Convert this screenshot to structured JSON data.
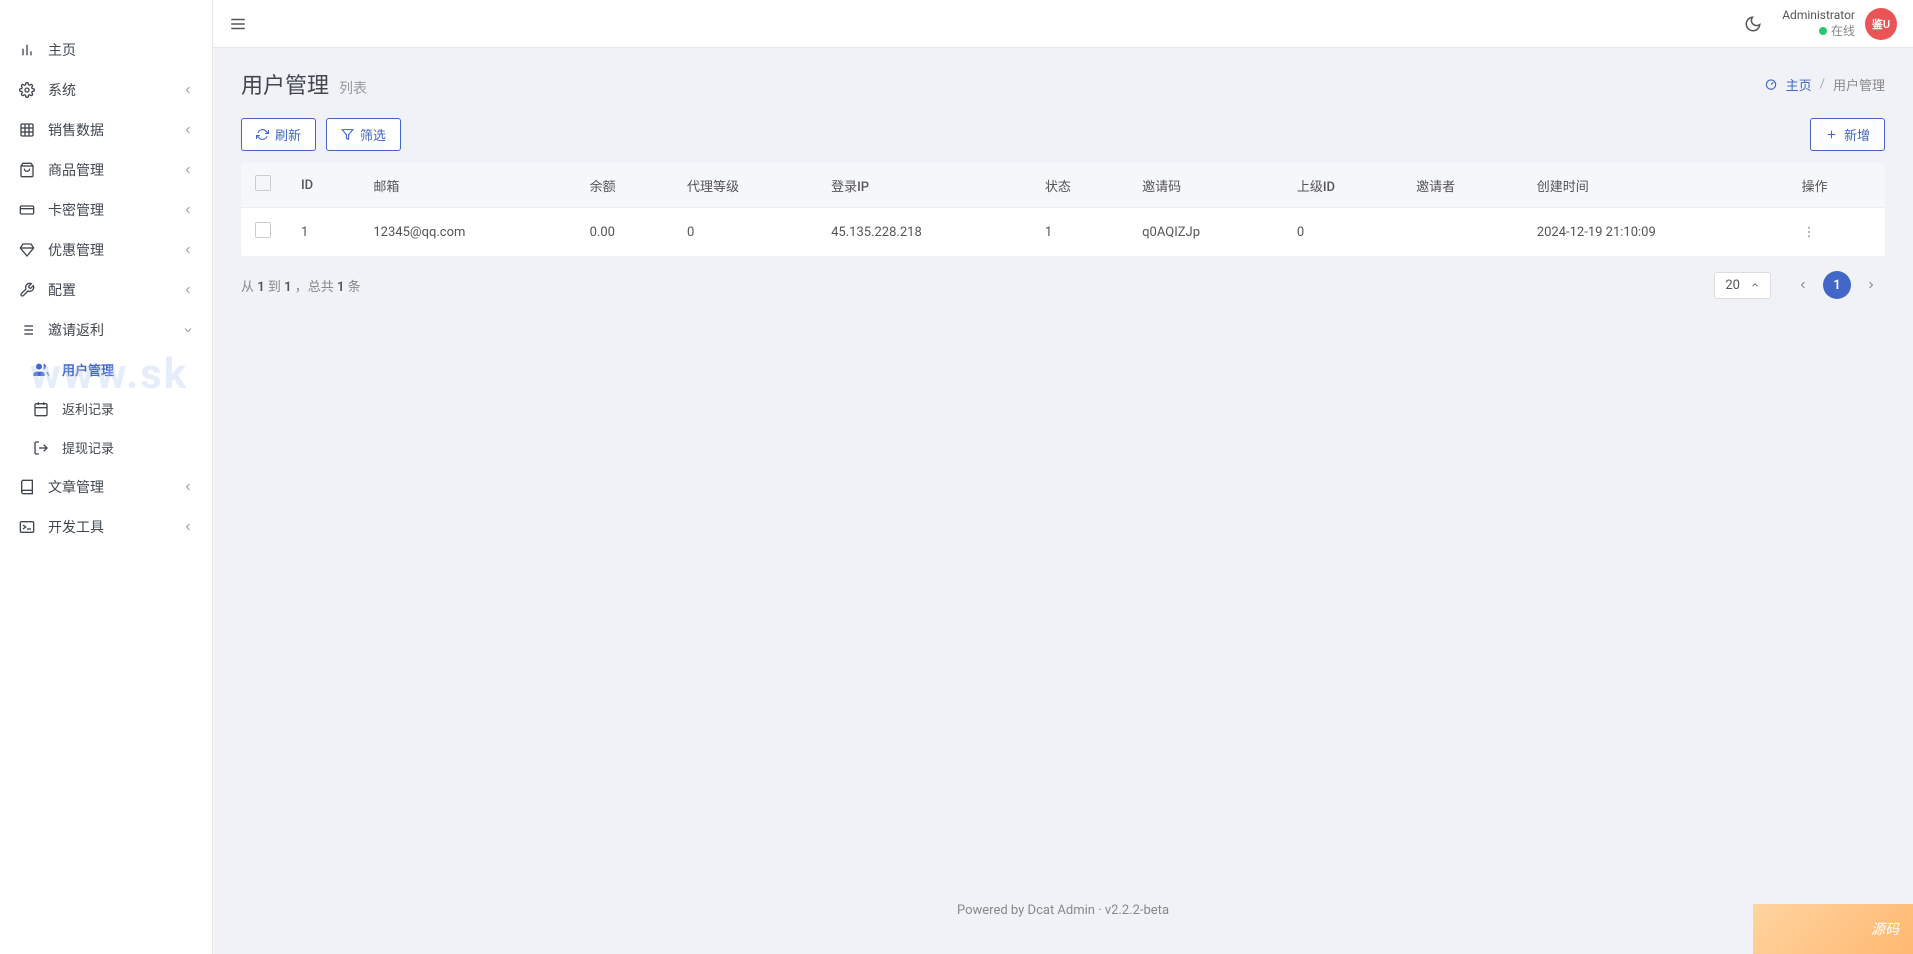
{
  "sidebar": {
    "items": [
      {
        "label": "主页",
        "icon": "bar-chart",
        "hasChildren": false
      },
      {
        "label": "系统",
        "icon": "gear",
        "hasChildren": true,
        "expanded": false
      },
      {
        "label": "销售数据",
        "icon": "grid",
        "hasChildren": true,
        "expanded": false
      },
      {
        "label": "商品管理",
        "icon": "shop",
        "hasChildren": true,
        "expanded": false
      },
      {
        "label": "卡密管理",
        "icon": "card",
        "hasChildren": true,
        "expanded": false
      },
      {
        "label": "优惠管理",
        "icon": "diamond",
        "hasChildren": true,
        "expanded": false
      },
      {
        "label": "配置",
        "icon": "wrench",
        "hasChildren": true,
        "expanded": false
      },
      {
        "label": "邀请返利",
        "icon": "list",
        "hasChildren": true,
        "expanded": true
      },
      {
        "label": "用户管理",
        "icon": "users",
        "sub": true,
        "active": true
      },
      {
        "label": "返利记录",
        "icon": "calendar",
        "sub": true
      },
      {
        "label": "提现记录",
        "icon": "arrow-out",
        "sub": true
      },
      {
        "label": "文章管理",
        "icon": "book",
        "hasChildren": true,
        "expanded": false
      },
      {
        "label": "开发工具",
        "icon": "terminal",
        "hasChildren": true,
        "expanded": false
      }
    ]
  },
  "topbar": {
    "user_name": "Administrator",
    "user_status": "在线",
    "avatar_text": "鉴U"
  },
  "page": {
    "title": "用户管理",
    "subtitle": "列表"
  },
  "breadcrumb": {
    "home": "主页",
    "current": "用户管理"
  },
  "toolbar": {
    "refresh": "刷新",
    "filter": "筛选",
    "create": "新增"
  },
  "table": {
    "columns": [
      "",
      "ID",
      "邮箱",
      "余额",
      "代理等级",
      "登录IP",
      "状态",
      "邀请码",
      "上级ID",
      "邀请者",
      "创建时间",
      "操作"
    ],
    "rows": [
      {
        "id": "1",
        "email": "12345@qq.com",
        "balance": "0.00",
        "agent_level": "0",
        "login_ip": "45.135.228.218",
        "status": "1",
        "invite_code": "q0AQIZJp",
        "parent_id": "0",
        "inviter": "",
        "created_at": "2024-12-19 21:10:09"
      }
    ]
  },
  "pagination": {
    "info_prefix": "从 ",
    "from": "1",
    "info_mid1": " 到 ",
    "to": "1",
    "info_mid2": " ，总共 ",
    "total": "1",
    "info_suffix": " 条",
    "page_size": "20",
    "current_page": "1"
  },
  "footer": {
    "powered_by_prefix": "Powered by ",
    "powered_by_link": "Dcat Admin",
    "sep": " · ",
    "version": "v2.2.2-beta"
  },
  "watermark": "www.sk",
  "corner_badge": "源码"
}
